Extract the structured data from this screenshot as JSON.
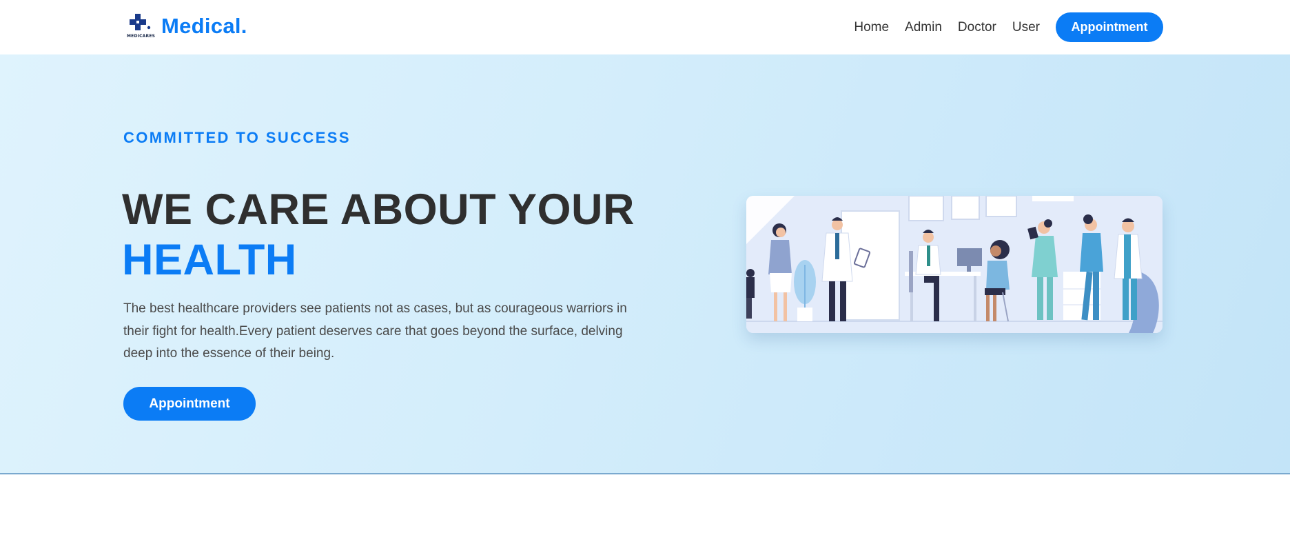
{
  "brand": {
    "name": "Medical.",
    "logo_text": "MEDICARES",
    "logo_icon": "medical-cross-icon"
  },
  "nav": {
    "links": [
      "Home",
      "Admin",
      "Doctor",
      "User"
    ],
    "cta_label": "Appointment"
  },
  "hero": {
    "tagline": "COMMITTED TO SUCCESS",
    "headline_line1": "WE CARE ABOUT YOUR",
    "headline_line2": "HEALTH",
    "description": "The best healthcare providers see patients not as cases, but as courageous warriors in their fight for health.Every patient deserves care that goes beyond the surface, delving deep into the essence of their being.",
    "cta_label": "Appointment",
    "illustration": "clinic-staff-patients-illustration"
  },
  "colors": {
    "accent": "#0b7cf5",
    "heading": "#2f2f2f",
    "hero_bg": "#d3edfb",
    "text": "#4a4a4a"
  }
}
